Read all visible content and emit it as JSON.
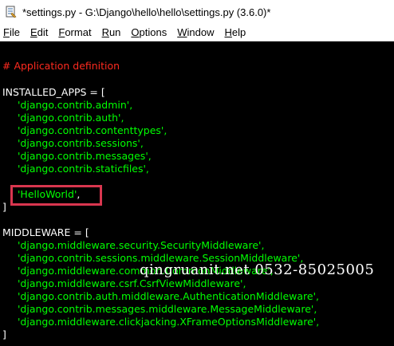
{
  "window": {
    "title": "*settings.py - G:\\Django\\hello\\hello\\settings.py (3.6.0)*"
  },
  "menu": [
    "File",
    "Edit",
    "Format",
    "Run",
    "Options",
    "Window",
    "Help"
  ],
  "menu_mnemonics": [
    "F",
    "E",
    "F",
    "R",
    "O",
    "W",
    "H"
  ],
  "code": {
    "comment": "# Application definition",
    "installed_apps_open": "INSTALLED_APPS = [",
    "apps": [
      "'django.contrib.admin',",
      "'django.contrib.auth',",
      "'django.contrib.contenttypes',",
      "'django.contrib.sessions',",
      "'django.contrib.messages',",
      "'django.contrib.staticfiles',"
    ],
    "helloworld": "'HelloWorld'",
    "helloworld_tail": ",",
    "close_bracket": "]",
    "middleware_open": "MIDDLEWARE = [",
    "middleware": [
      "'django.middleware.security.SecurityMiddleware',",
      "'django.contrib.sessions.middleware.SessionMiddleware',",
      "'django.middleware.common.CommonMiddleware',",
      "'django.middleware.csrf.CsrfViewMiddleware',",
      "'django.contrib.auth.middleware.AuthenticationMiddleware',",
      "'django.contrib.messages.middleware.MessageMiddleware',",
      "'django.middleware.clickjacking.XFrameOptionsMiddleware',"
    ]
  },
  "watermark": "qingruanit.net 0532-85025005",
  "colors": {
    "background": "#000000",
    "comment": "#ff2a1f",
    "string": "#00ff00",
    "text": "#ffffff",
    "highlight": "#d9364f"
  }
}
